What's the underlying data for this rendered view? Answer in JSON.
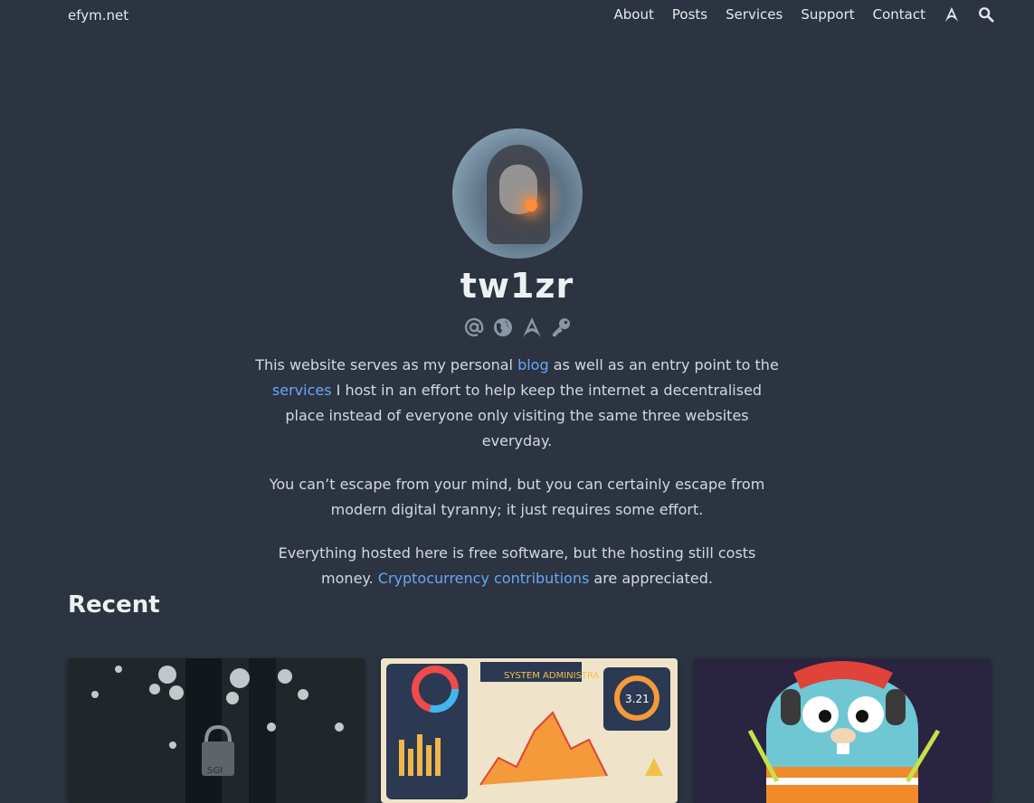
{
  "nav": {
    "brand": "efym.net",
    "items": [
      "About",
      "Posts",
      "Services",
      "Support",
      "Contact"
    ],
    "icons": [
      "arch-icon",
      "search-icon"
    ]
  },
  "profile": {
    "name": "tw1zr",
    "social_icons": [
      "at-icon",
      "globe-icon",
      "arch-icon",
      "key-icon"
    ]
  },
  "bio": {
    "p1_a": "This website serves as my personal ",
    "p1_link1": "blog",
    "p1_b": " as well as an entry point to the ",
    "p1_link2": "services",
    "p1_c": " I host in an effort to help keep the internet a decentralised place instead of everyone only visiting the same three websites everyday.",
    "p2": "You can’t escape from your mind, but you can certainly escape from modern digital tyranny; it just requires some effort.",
    "p3_a": "Everything hosted here is free software, but the hosting still costs money. ",
    "p3_link": "Cryptocurrency contributions",
    "p3_b": " are appreciated."
  },
  "recent": {
    "heading": "Recent",
    "cards": [
      {
        "image": "padlock-image"
      },
      {
        "image": "dashboard-image",
        "overlay_text": "SYSTEM ADMINISTRA"
      },
      {
        "image": "gopher-image"
      }
    ]
  },
  "colors": {
    "background": "#2b3440",
    "link": "#6aa6f8",
    "text": "#d4d9df"
  }
}
